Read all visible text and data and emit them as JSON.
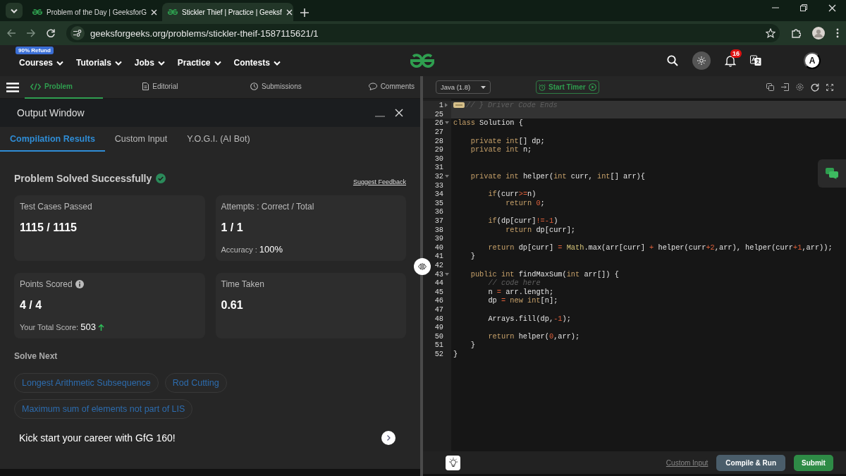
{
  "browser": {
    "tabs": [
      {
        "title": "Problem of the Day | GeeksforG",
        "selected": false
      },
      {
        "title": "Stickler Thief | Practice | Geeksf",
        "selected": true
      }
    ],
    "url": "geeksforgeeks.org/problems/stickler-theif-1587115621/1"
  },
  "site_nav": {
    "badge": "90% Refund",
    "items": [
      {
        "label": "Courses"
      },
      {
        "label": "Tutorials"
      },
      {
        "label": "Jobs"
      },
      {
        "label": "Practice"
      },
      {
        "label": "Contests"
      }
    ],
    "notification_count": "16",
    "avatar": "A"
  },
  "problem_tabs": [
    {
      "label": "Problem",
      "selected": true
    },
    {
      "label": "Editorial",
      "selected": false
    },
    {
      "label": "Submissions",
      "selected": false
    },
    {
      "label": "Comments",
      "selected": false
    }
  ],
  "editor_toolbar": {
    "language": "Java (1.8)",
    "timer_button": "Start Timer"
  },
  "output_window": {
    "title": "Output Window",
    "tabs": [
      {
        "label": "Compilation Results",
        "selected": true
      },
      {
        "label": "Custom Input",
        "selected": false
      },
      {
        "label": "Y.O.G.I. (AI Bot)",
        "selected": false
      }
    ],
    "status": "Problem Solved Successfully",
    "feedback_link": "Suggest Feedback",
    "cards": [
      {
        "label": "Test Cases Passed",
        "value": "1115 / 1115",
        "info": false
      },
      {
        "label": "Attempts : Correct / Total",
        "value": "1 / 1",
        "info": false,
        "detail_label": "Accuracy :",
        "detail_value": "100%"
      },
      {
        "label": "Points Scored",
        "value": "4 / 4",
        "info": true,
        "detail_label": "Your Total Score:",
        "detail_value": "503",
        "rising": true
      },
      {
        "label": "Time Taken",
        "value": "0.61",
        "info": false
      }
    ],
    "solve_next_title": "Solve Next",
    "suggestions": [
      "Longest Arithmetic Subsequence",
      "Rod Cutting",
      "Maximum sum of elements not part of LIS"
    ],
    "promo": "Kick start your career with GfG 160!"
  },
  "editor": {
    "lines": [
      {
        "number": "1",
        "foldable": true,
        "folded": true,
        "highlighted": true,
        "tokens": [
          {
            "kind": "comment",
            "text": "// } Driver Code Ends"
          }
        ]
      },
      {
        "number": "25",
        "foldable": false,
        "highlighted": true
      },
      {
        "number": "26",
        "foldable": true,
        "folded": false,
        "highlighted": false,
        "tokens": [
          {
            "kind": "keyword",
            "text": "class"
          },
          {
            "kind": "plain",
            "text": " Solution {"
          }
        ]
      },
      {
        "number": "27",
        "foldable": false,
        "highlighted": false
      },
      {
        "number": "28",
        "foldable": false,
        "highlighted": false,
        "tokens": [
          {
            "kind": "keyword",
            "text": "    private"
          },
          {
            "kind": "keyword",
            "text": " int"
          },
          {
            "kind": "plain",
            "text": "[] dp;"
          }
        ]
      },
      {
        "number": "29",
        "foldable": false,
        "highlighted": false,
        "tokens": [
          {
            "kind": "keyword",
            "text": "    private"
          },
          {
            "kind": "keyword",
            "text": " int"
          },
          {
            "kind": "plain",
            "text": " n;"
          }
        ]
      },
      {
        "number": "30",
        "foldable": false,
        "highlighted": false
      },
      {
        "number": "31",
        "foldable": false,
        "highlighted": false
      },
      {
        "number": "32",
        "foldable": true,
        "folded": false,
        "highlighted": false,
        "tokens": [
          {
            "kind": "keyword",
            "text": "    private"
          },
          {
            "kind": "keyword",
            "text": " int"
          },
          {
            "kind": "plain",
            "text": " helper("
          },
          {
            "kind": "keyword",
            "text": "int"
          },
          {
            "kind": "plain",
            "text": " curr, "
          },
          {
            "kind": "keyword",
            "text": "int"
          },
          {
            "kind": "plain",
            "text": "[] arr){"
          }
        ]
      },
      {
        "number": "33",
        "foldable": false,
        "highlighted": false
      },
      {
        "number": "34",
        "foldable": false,
        "highlighted": false,
        "tokens": [
          {
            "kind": "keyword",
            "text": "        if"
          },
          {
            "kind": "plain",
            "text": "(curr"
          },
          {
            "kind": "operator",
            "text": ">="
          },
          {
            "kind": "plain",
            "text": "n)"
          }
        ]
      },
      {
        "number": "35",
        "foldable": false,
        "highlighted": false,
        "tokens": [
          {
            "kind": "keyword",
            "text": "            return"
          },
          {
            "kind": "number",
            "text": " 0"
          },
          {
            "kind": "plain",
            "text": ";"
          }
        ]
      },
      {
        "number": "36",
        "foldable": false,
        "highlighted": false
      },
      {
        "number": "37",
        "foldable": false,
        "highlighted": false,
        "tokens": [
          {
            "kind": "keyword",
            "text": "        if"
          },
          {
            "kind": "plain",
            "text": "(dp[curr]"
          },
          {
            "kind": "operator",
            "text": "!="
          },
          {
            "kind": "number",
            "text": "-1"
          },
          {
            "kind": "plain",
            "text": ")"
          }
        ]
      },
      {
        "number": "38",
        "foldable": false,
        "highlighted": false,
        "tokens": [
          {
            "kind": "keyword",
            "text": "            return"
          },
          {
            "kind": "plain",
            "text": " dp[curr];"
          }
        ]
      },
      {
        "number": "39",
        "foldable": false,
        "highlighted": false
      },
      {
        "number": "40",
        "foldable": false,
        "highlighted": false,
        "tokens": [
          {
            "kind": "keyword",
            "text": "        return"
          },
          {
            "kind": "plain",
            "text": " dp[curr] "
          },
          {
            "kind": "operator",
            "text": "="
          },
          {
            "kind": "class",
            "text": " Math"
          },
          {
            "kind": "plain",
            "text": ".max(arr[curr] "
          },
          {
            "kind": "operator",
            "text": "+"
          },
          {
            "kind": "plain",
            "text": " helper(curr"
          },
          {
            "kind": "number",
            "text": "+2"
          },
          {
            "kind": "plain",
            "text": ",arr), helper(curr"
          },
          {
            "kind": "number",
            "text": "+1"
          },
          {
            "kind": "plain",
            "text": ",arr));"
          }
        ]
      },
      {
        "number": "41",
        "foldable": false,
        "highlighted": false,
        "tokens": [
          {
            "kind": "plain",
            "text": "    }"
          }
        ]
      },
      {
        "number": "42",
        "foldable": false,
        "highlighted": false
      },
      {
        "number": "43",
        "foldable": true,
        "folded": false,
        "highlighted": false,
        "tokens": [
          {
            "kind": "keyword",
            "text": "    public"
          },
          {
            "kind": "keyword",
            "text": " int"
          },
          {
            "kind": "plain",
            "text": " findMaxSum("
          },
          {
            "kind": "keyword",
            "text": "int"
          },
          {
            "kind": "plain",
            "text": " arr[]) {"
          }
        ]
      },
      {
        "number": "44",
        "foldable": false,
        "highlighted": false,
        "tokens": [
          {
            "kind": "comment",
            "text": "        // code here"
          }
        ]
      },
      {
        "number": "45",
        "foldable": false,
        "highlighted": false,
        "tokens": [
          {
            "kind": "plain",
            "text": "        n "
          },
          {
            "kind": "operator",
            "text": "="
          },
          {
            "kind": "plain",
            "text": " arr.length;"
          }
        ]
      },
      {
        "number": "46",
        "foldable": false,
        "highlighted": false,
        "tokens": [
          {
            "kind": "plain",
            "text": "        dp "
          },
          {
            "kind": "operator",
            "text": "="
          },
          {
            "kind": "keyword",
            "text": " new"
          },
          {
            "kind": "keyword",
            "text": " int"
          },
          {
            "kind": "plain",
            "text": "[n];"
          }
        ]
      },
      {
        "number": "47",
        "foldable": false,
        "highlighted": false
      },
      {
        "number": "48",
        "foldable": false,
        "highlighted": false,
        "tokens": [
          {
            "kind": "plain",
            "text": "        Arrays.fill(dp,"
          },
          {
            "kind": "number",
            "text": "-1"
          },
          {
            "kind": "plain",
            "text": ");"
          }
        ]
      },
      {
        "number": "49",
        "foldable": false,
        "highlighted": false
      },
      {
        "number": "50",
        "foldable": false,
        "highlighted": false,
        "tokens": [
          {
            "kind": "keyword",
            "text": "        return"
          },
          {
            "kind": "plain",
            "text": " helper("
          },
          {
            "kind": "number",
            "text": "0"
          },
          {
            "kind": "plain",
            "text": ",arr);"
          }
        ]
      },
      {
        "number": "51",
        "foldable": false,
        "highlighted": false,
        "tokens": [
          {
            "kind": "plain",
            "text": "    }"
          }
        ]
      },
      {
        "number": "52",
        "foldable": false,
        "highlighted": false,
        "tokens": [
          {
            "kind": "plain",
            "text": "}"
          }
        ]
      }
    ]
  },
  "footer": {
    "custom_input_link": "Custom Input",
    "compile_button": "Compile & Run",
    "submit_button": "Submit"
  }
}
